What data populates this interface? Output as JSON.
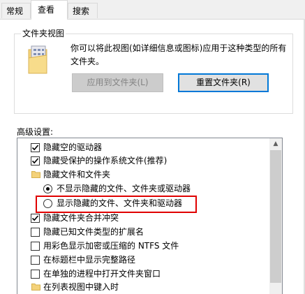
{
  "tabs": [
    {
      "label": "常规"
    },
    {
      "label": "查看"
    },
    {
      "label": "搜索"
    }
  ],
  "folder_view": {
    "title": "文件夹视图",
    "description": "你可以将此视图(如详细信息或图标)应用于这种类型的所有文件夹。",
    "apply_button": "应用到文件夹(L)",
    "reset_button": "重置文件夹(R)"
  },
  "advanced": {
    "label": "高级设置:",
    "items": [
      {
        "type": "checkbox",
        "checked": true,
        "label": "隐藏空的驱动器"
      },
      {
        "type": "checkbox",
        "checked": true,
        "label": "隐藏受保护的操作系统文件(推荐)"
      },
      {
        "type": "folder",
        "label": "隐藏文件和文件夹"
      },
      {
        "type": "radio",
        "checked": true,
        "label": "不显示隐藏的文件、文件夹或驱动器"
      },
      {
        "type": "radio",
        "checked": false,
        "label": "显示隐藏的文件、文件夹和驱动器"
      },
      {
        "type": "checkbox",
        "checked": true,
        "label": "隐藏文件夹合并冲突"
      },
      {
        "type": "checkbox",
        "checked": false,
        "label": "隐藏已知文件类型的扩展名"
      },
      {
        "type": "checkbox",
        "checked": false,
        "label": "用彩色显示加密或压缩的 NTFS 文件"
      },
      {
        "type": "checkbox",
        "checked": false,
        "label": "在标题栏中显示完整路径"
      },
      {
        "type": "checkbox",
        "checked": false,
        "label": "在单独的进程中打开文件夹窗口"
      },
      {
        "type": "folder",
        "label": "在列表视图中键入时"
      }
    ]
  },
  "colors": {
    "highlight": "#e00000",
    "default_button_border": "#0078d7"
  }
}
